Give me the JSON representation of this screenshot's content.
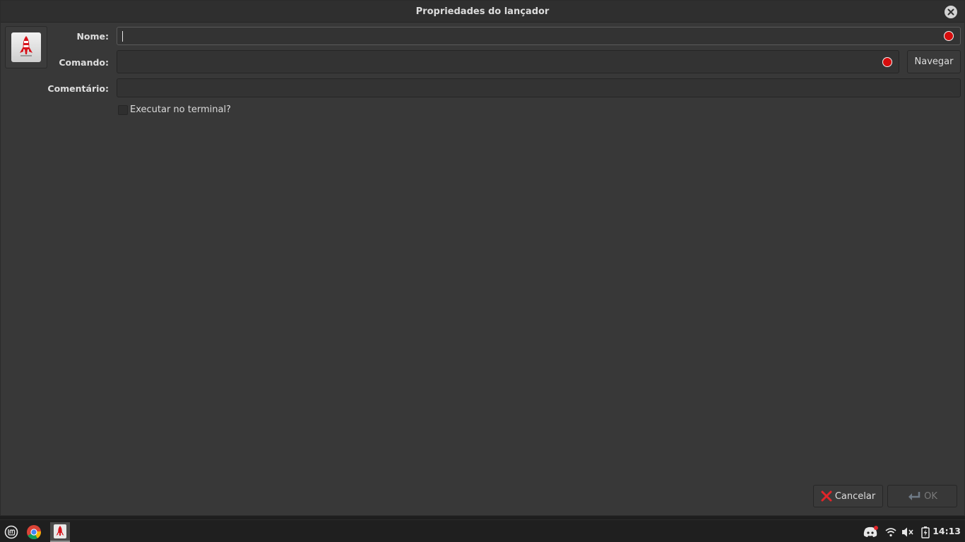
{
  "window": {
    "title": "Propriedades do lançador",
    "icon_name": "rocket-icon"
  },
  "form": {
    "name_label": "Nome:",
    "name_value": "",
    "command_label": "Comando:",
    "command_value": "",
    "browse_label": "Navegar",
    "comment_label": "Comentário:",
    "comment_value": "",
    "terminal_label": "Executar no terminal?",
    "terminal_checked": false
  },
  "actions": {
    "cancel_label": "Cancelar",
    "ok_label": "OK",
    "ok_enabled": false
  },
  "taskbar": {
    "apps": [
      "mint-menu-icon",
      "chrome-icon",
      "rocket-launcher-icon"
    ],
    "tray": [
      "discord-icon",
      "wifi-icon",
      "volume-muted-icon",
      "battery-charging-icon"
    ],
    "clock": "14:13"
  },
  "colors": {
    "error_dot": "#d50d0d",
    "window_bg": "#383838",
    "taskbar_bg": "#1f1f1f"
  }
}
